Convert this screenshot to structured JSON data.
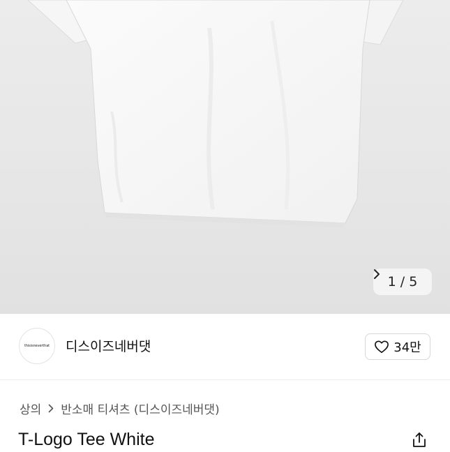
{
  "gallery": {
    "image_alt": "white t-shirt product photo",
    "counter": "1 / 5",
    "next_icon": "chevron-right-icon"
  },
  "seller": {
    "name": "디스이즈네버댓",
    "avatar_text": "thisisneverthat",
    "like_icon": "heart-outline-icon",
    "like_count": "34만"
  },
  "breadcrumb": {
    "items": [
      "상의",
      "반소매 티셔츠 (디스이즈네버댓)"
    ],
    "separator_icon": "chevron-right-icon"
  },
  "product": {
    "title": "T-Logo Tee White",
    "share_icon": "share-icon"
  }
}
